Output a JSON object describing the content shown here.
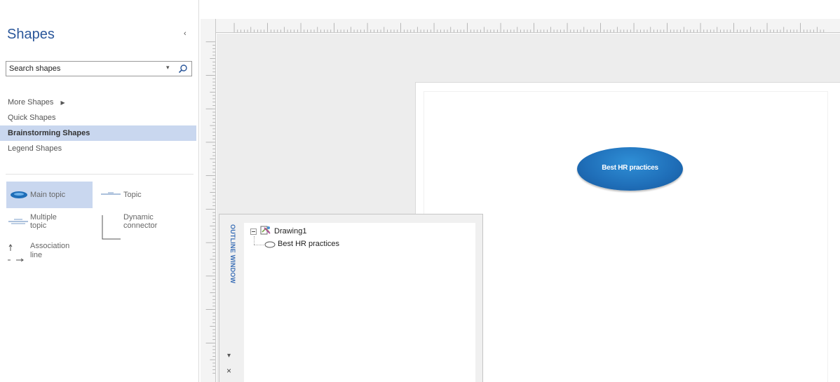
{
  "shapes_pane": {
    "title": "Shapes",
    "collapse_glyph": "‹",
    "search": {
      "placeholder": "Search shapes",
      "dropdown_glyph": "▾"
    },
    "stencils": [
      {
        "label": "More Shapes",
        "arrow": "▶"
      },
      {
        "label": "Quick Shapes"
      },
      {
        "label": "Brainstorming Shapes",
        "active": true
      },
      {
        "label": "Legend Shapes"
      }
    ],
    "masters": {
      "main_topic": "Main topic",
      "topic": "Topic",
      "multiple_topic_line1": "Multiple",
      "multiple_topic_line2": "topic",
      "dynamic_connector_line1": "Dynamic",
      "dynamic_connector_line2": "connector",
      "association_line_line1": "Association",
      "association_line_line2": "line"
    }
  },
  "canvas": {
    "main_topic_shape": "Best HR practices",
    "colors": {
      "topic_fill": "#1f6eb8",
      "canvas_bg": "#ededed",
      "accent": "#2b579a"
    }
  },
  "outline_window": {
    "tab_label": "OUTLINE WINDOW",
    "pin_glyph": "▾",
    "close_glyph": "×",
    "tree": {
      "root_label": "Drawing1",
      "child_label": "Best HR practices"
    }
  },
  "icons": [
    "search-icon",
    "drawing-icon",
    "ellipse-topic-icon",
    "main-topic-icon",
    "topic-line-icon",
    "multiple-topic-icon",
    "dynamic-connector-icon",
    "association-line-icon"
  ]
}
